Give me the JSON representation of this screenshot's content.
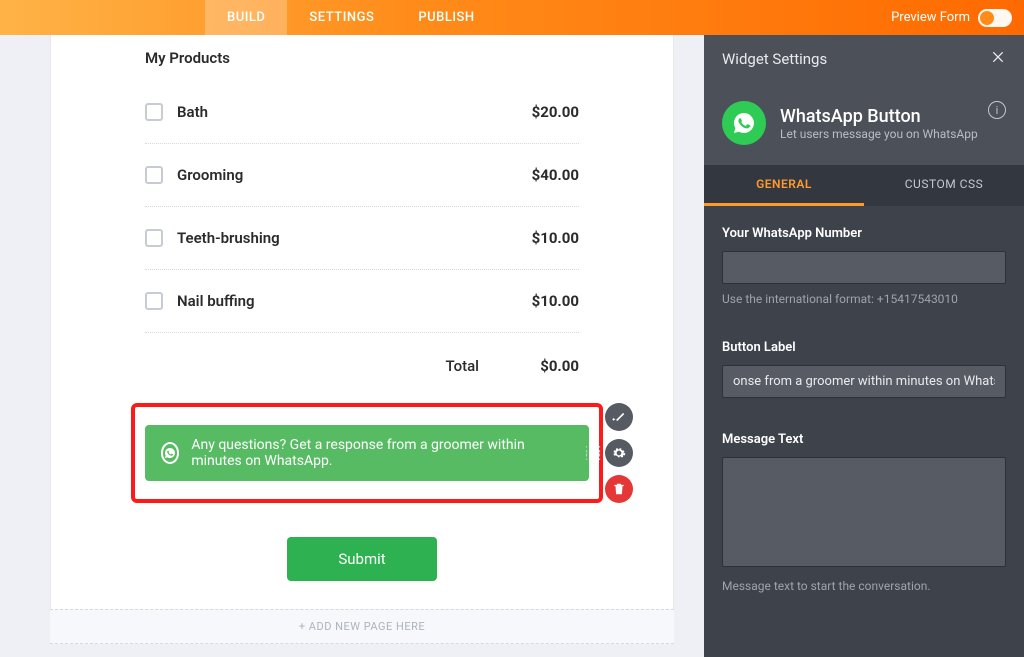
{
  "nav": {
    "tabs": [
      "BUILD",
      "SETTINGS",
      "PUBLISH"
    ],
    "preview_label": "Preview Form"
  },
  "form": {
    "section_title": "My Products",
    "products": [
      {
        "label": "Bath",
        "price": "$20.00"
      },
      {
        "label": "Grooming",
        "price": "$40.00"
      },
      {
        "label": "Teeth-brushing",
        "price": "$10.00"
      },
      {
        "label": "Nail buffing",
        "price": "$10.00"
      }
    ],
    "total_label": "Total",
    "total_amount": "$0.00",
    "whatsapp_button_text": "Any questions? Get a response from a groomer within minutes on WhatsApp.",
    "submit_label": "Submit",
    "add_page_label": "+ ADD NEW PAGE HERE"
  },
  "panel": {
    "header": "Widget Settings",
    "widget_title": "WhatsApp Button",
    "widget_subtitle": "Let users message you on WhatsApp",
    "tabs": {
      "general": "GENERAL",
      "css": "CUSTOM CSS"
    },
    "fields": {
      "number_label": "Your WhatsApp Number",
      "number_value": "",
      "number_hint": "Use the international format: +15417543010",
      "button_label_label": "Button Label",
      "button_label_value": "onse from a groomer within minutes on WhatsApp.",
      "message_label": "Message Text",
      "message_value": "",
      "message_hint": "Message text to start the conversation."
    }
  }
}
